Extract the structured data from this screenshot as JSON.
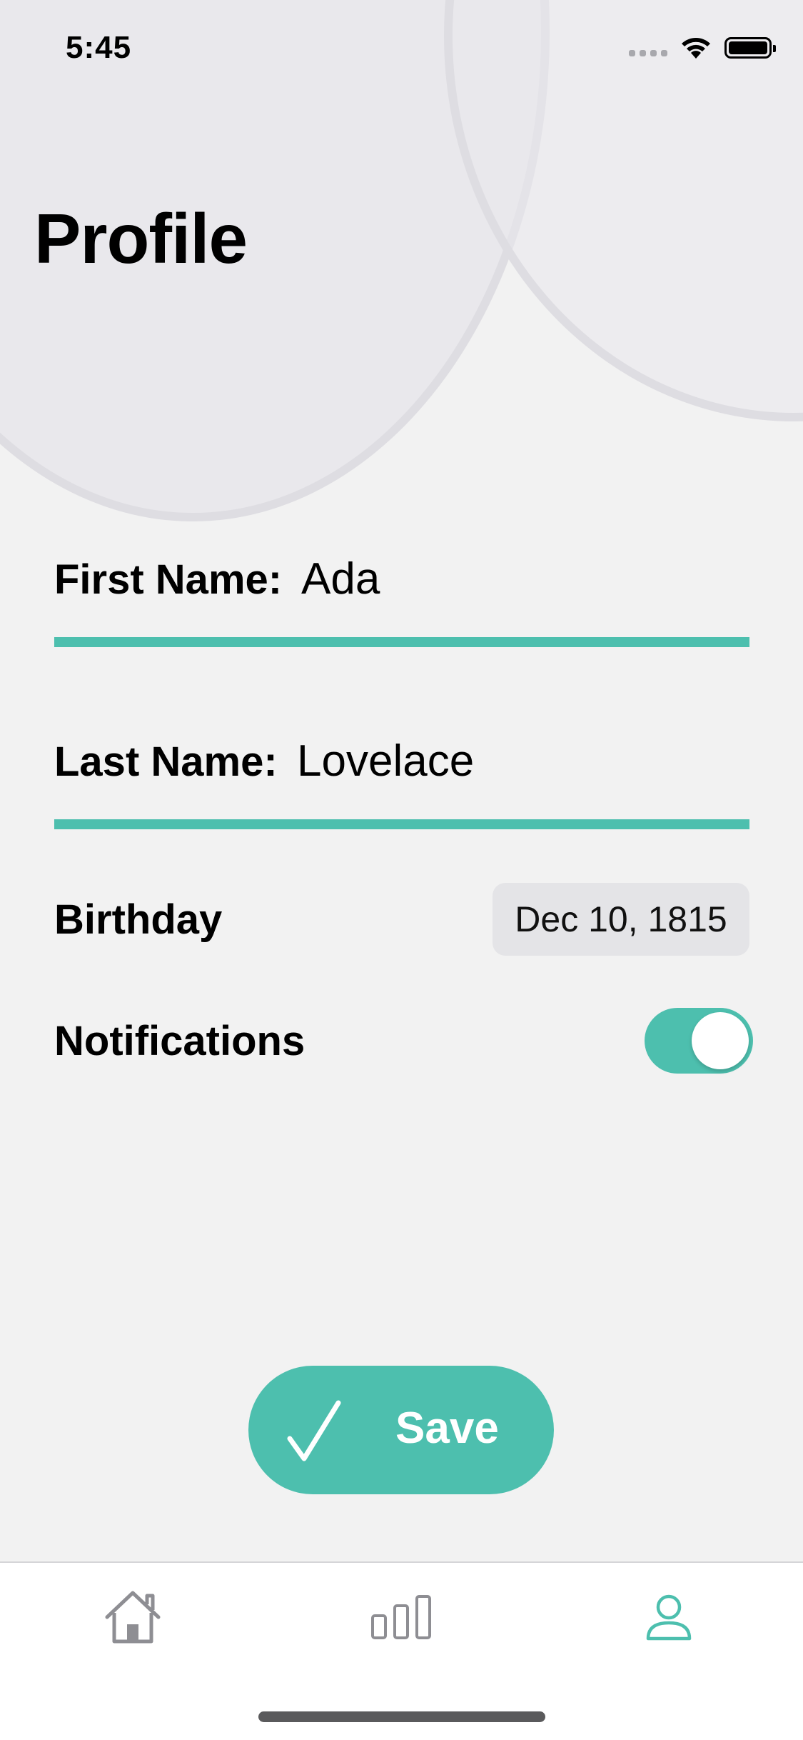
{
  "status_bar": {
    "time": "5:45",
    "icons": [
      "cellular-signal-icon",
      "wifi-icon",
      "battery-icon"
    ]
  },
  "page": {
    "title": "Profile"
  },
  "form": {
    "first_name": {
      "label": "First Name:",
      "value": "Ada"
    },
    "last_name": {
      "label": "Last Name:",
      "value": "Lovelace"
    },
    "birthday": {
      "label": "Birthday",
      "value": "Dec 10, 1815"
    },
    "notifications": {
      "label": "Notifications",
      "enabled": true
    }
  },
  "save_button": {
    "label": "Save",
    "icon": "checkmark-icon"
  },
  "tab_bar": {
    "items": [
      {
        "icon": "home-icon",
        "selected": false
      },
      {
        "icon": "bar-chart-icon",
        "selected": false
      },
      {
        "icon": "person-icon",
        "selected": true
      }
    ]
  },
  "colors": {
    "accent": "#4dbfae",
    "background": "#f2f2f2",
    "decor_circle": "#e9e8ec",
    "tab_inactive": "#8e8e93"
  }
}
